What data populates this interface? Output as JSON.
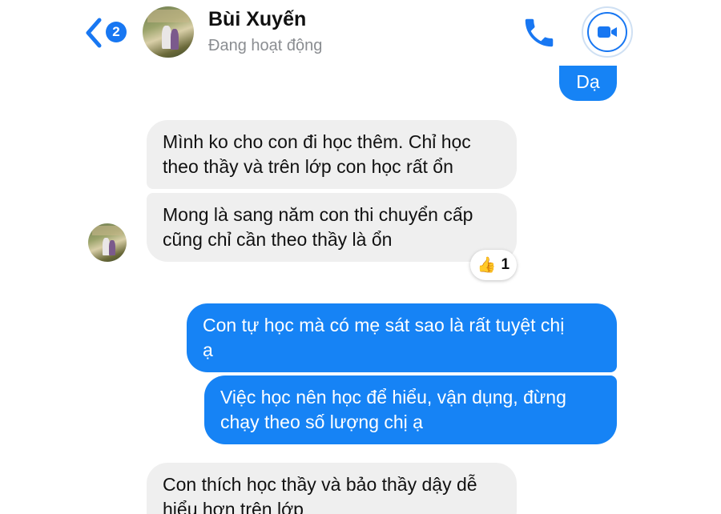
{
  "header": {
    "unread_count": "2",
    "contact_name": "Bùi Xuyến",
    "status": "Đang hoạt động",
    "icons": [
      "back-chevron-icon",
      "phone-icon",
      "video-call-icon"
    ]
  },
  "messages": [
    {
      "side": "out",
      "text": "Dạ"
    },
    {
      "side": "in",
      "line1": "Mình ko cho con đi học thêm. Chỉ học",
      "line2": "theo thầy và trên lớp con học rất ổn"
    },
    {
      "side": "in",
      "line1": "Mong là sang năm con thi chuyển cấp",
      "line2": "cũng chỉ cần theo thầy là ổn"
    },
    {
      "side": "out",
      "line1": "Con tự học mà có mẹ sát sao là rất tuyệt chị",
      "line2": "ạ"
    },
    {
      "side": "out",
      "line1": "Việc học nên học để hiểu, vận dụng, đừng",
      "line2": "chạy theo số lượng chị ạ"
    },
    {
      "side": "in",
      "line1": "Con thích học thầy và bảo thầy dậy dễ",
      "line2": "hiểu hơn trên lớp"
    }
  ],
  "reaction": {
    "emoji": "👍",
    "count": "1"
  },
  "colors": {
    "accent": "#1877f2",
    "outgoing_bubble": "#1683f5",
    "incoming_bubble": "#efefef",
    "status_text": "#8a8d91"
  }
}
